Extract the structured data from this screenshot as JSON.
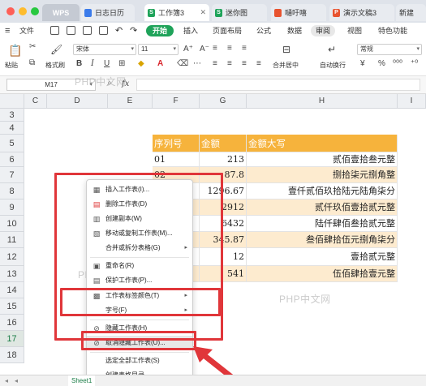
{
  "window": {
    "tabs": [
      {
        "label": "WPS"
      },
      {
        "label": "日志日历",
        "color": "#3b7bea",
        "icon": "calendar-icon"
      },
      {
        "label": "工作簿3",
        "color": "#1fa35a",
        "icon": "spreadsheet-icon",
        "active": true
      },
      {
        "label": "迷你图",
        "color": "#1fa35a",
        "icon": "spreadsheet-icon"
      },
      {
        "label": "嗵吁嘻",
        "color": "#e8532f",
        "icon": "document-icon"
      },
      {
        "label": "演示文稿3",
        "color": "#e8532f",
        "icon": "presentation-icon"
      },
      {
        "label": "新建"
      }
    ]
  },
  "menubar": {
    "file": "文件",
    "start": "开始",
    "items": [
      "插入",
      "页面布局",
      "公式",
      "数据",
      "审阅",
      "视图",
      "特色功能"
    ]
  },
  "toolbar": {
    "paste": "粘贴",
    "format_painter": "格式刷",
    "font_name": "宋体",
    "font_size": "11",
    "merge": "合并居中",
    "wrap": "自动换行",
    "number_format": "常规",
    "currency": "¥",
    "percent": "%"
  },
  "formula_bar": {
    "name_box": "M17",
    "fx": "fx"
  },
  "sheet": {
    "columns": [
      "C",
      "D",
      "E",
      "F",
      "G",
      "H",
      "I"
    ],
    "rows": [
      "3",
      "4",
      "5",
      "6",
      "7",
      "8",
      "9",
      "10",
      "11",
      "12",
      "13",
      "14",
      "15",
      "16",
      "17",
      "18"
    ],
    "header": {
      "f": "序列号",
      "g": "金额",
      "h": "金额大写"
    },
    "data": [
      {
        "f": "01",
        "g": "213",
        "h": "贰佰壹拾叁元整"
      },
      {
        "f": "02",
        "g": "87.8",
        "h": "捌拾柒元捌角整"
      },
      {
        "f": "",
        "g": "1296.67",
        "h": "壹仟贰佰玖拾陆元陆角柒分"
      },
      {
        "f": "",
        "g": "2912",
        "h": "贰仟玖佰壹拾贰元整"
      },
      {
        "f": "",
        "g": "6432",
        "h": "陆仟肆佰叁拾贰元整"
      },
      {
        "f": "",
        "g": "345.87",
        "h": "叁佰肆拾伍元捌角柒分"
      },
      {
        "f": "",
        "g": "12",
        "h": "壹拾贰元整"
      },
      {
        "f": "",
        "g": "541",
        "h": "伍佰肆拾壹元整"
      }
    ],
    "header_color": "#f6b33c",
    "band_color": "#fdebcf",
    "selected_row": "17"
  },
  "context_menu": {
    "items": [
      {
        "label": "插入工作表(I)...",
        "icon": "insert-sheet-icon"
      },
      {
        "label": "删除工作表(D)",
        "icon": "delete-sheet-icon"
      },
      {
        "label": "创建副本(W)",
        "icon": "copy-sheet-icon"
      },
      {
        "label": "移动或复制工作表(M)...",
        "icon": "move-sheet-icon"
      },
      {
        "label": "合并或拆分表格(G)",
        "icon": "",
        "submenu": true
      },
      {
        "label": "重命名(R)",
        "icon": "rename-icon"
      },
      {
        "label": "保护工作表(P)...",
        "icon": "protect-sheet-icon"
      },
      {
        "label": "工作表标签颜色(T)",
        "icon": "tab-color-icon",
        "submenu": true
      },
      {
        "label": "字号(F)",
        "icon": "",
        "submenu": true
      },
      {
        "label": "隐藏工作表(H)",
        "icon": "hide-icon"
      },
      {
        "label": "取消隐藏工作表(U)...",
        "icon": "unhide-icon",
        "highlighted": true
      },
      {
        "label": "选定全部工作表(S)",
        "icon": ""
      },
      {
        "label": "创建表格目录...",
        "icon": ""
      }
    ]
  },
  "sheet_tab": {
    "label": "Sheet1"
  },
  "watermark": "PHP中文网",
  "annotation_color": "#e0363a"
}
